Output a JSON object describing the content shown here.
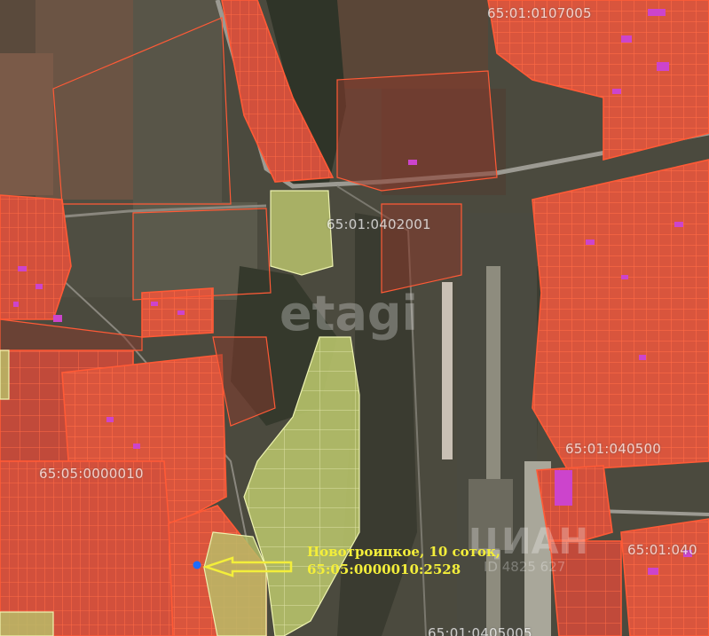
{
  "map": {
    "parcel_labels": [
      "65:01:0107005",
      "65:01:0402001",
      "65:05:0000010",
      "65:01:040500",
      "65:01:040",
      "65:01:0405005"
    ],
    "annotation": {
      "line1": "Новотроицкое, 10 соток,",
      "line2": "65:05:0000010:2528"
    },
    "watermarks": {
      "etagi": "etagi",
      "cian": "ЦИАН",
      "cian_id": "ID 4825 627"
    },
    "colors": {
      "parcel_fill": "#e0503a",
      "parcel_border": "#ff5a36",
      "building": "#cc44cc",
      "highlight": "#d8e07a",
      "marker": "#1e6cff",
      "arrow": "#f3ee3a"
    }
  }
}
